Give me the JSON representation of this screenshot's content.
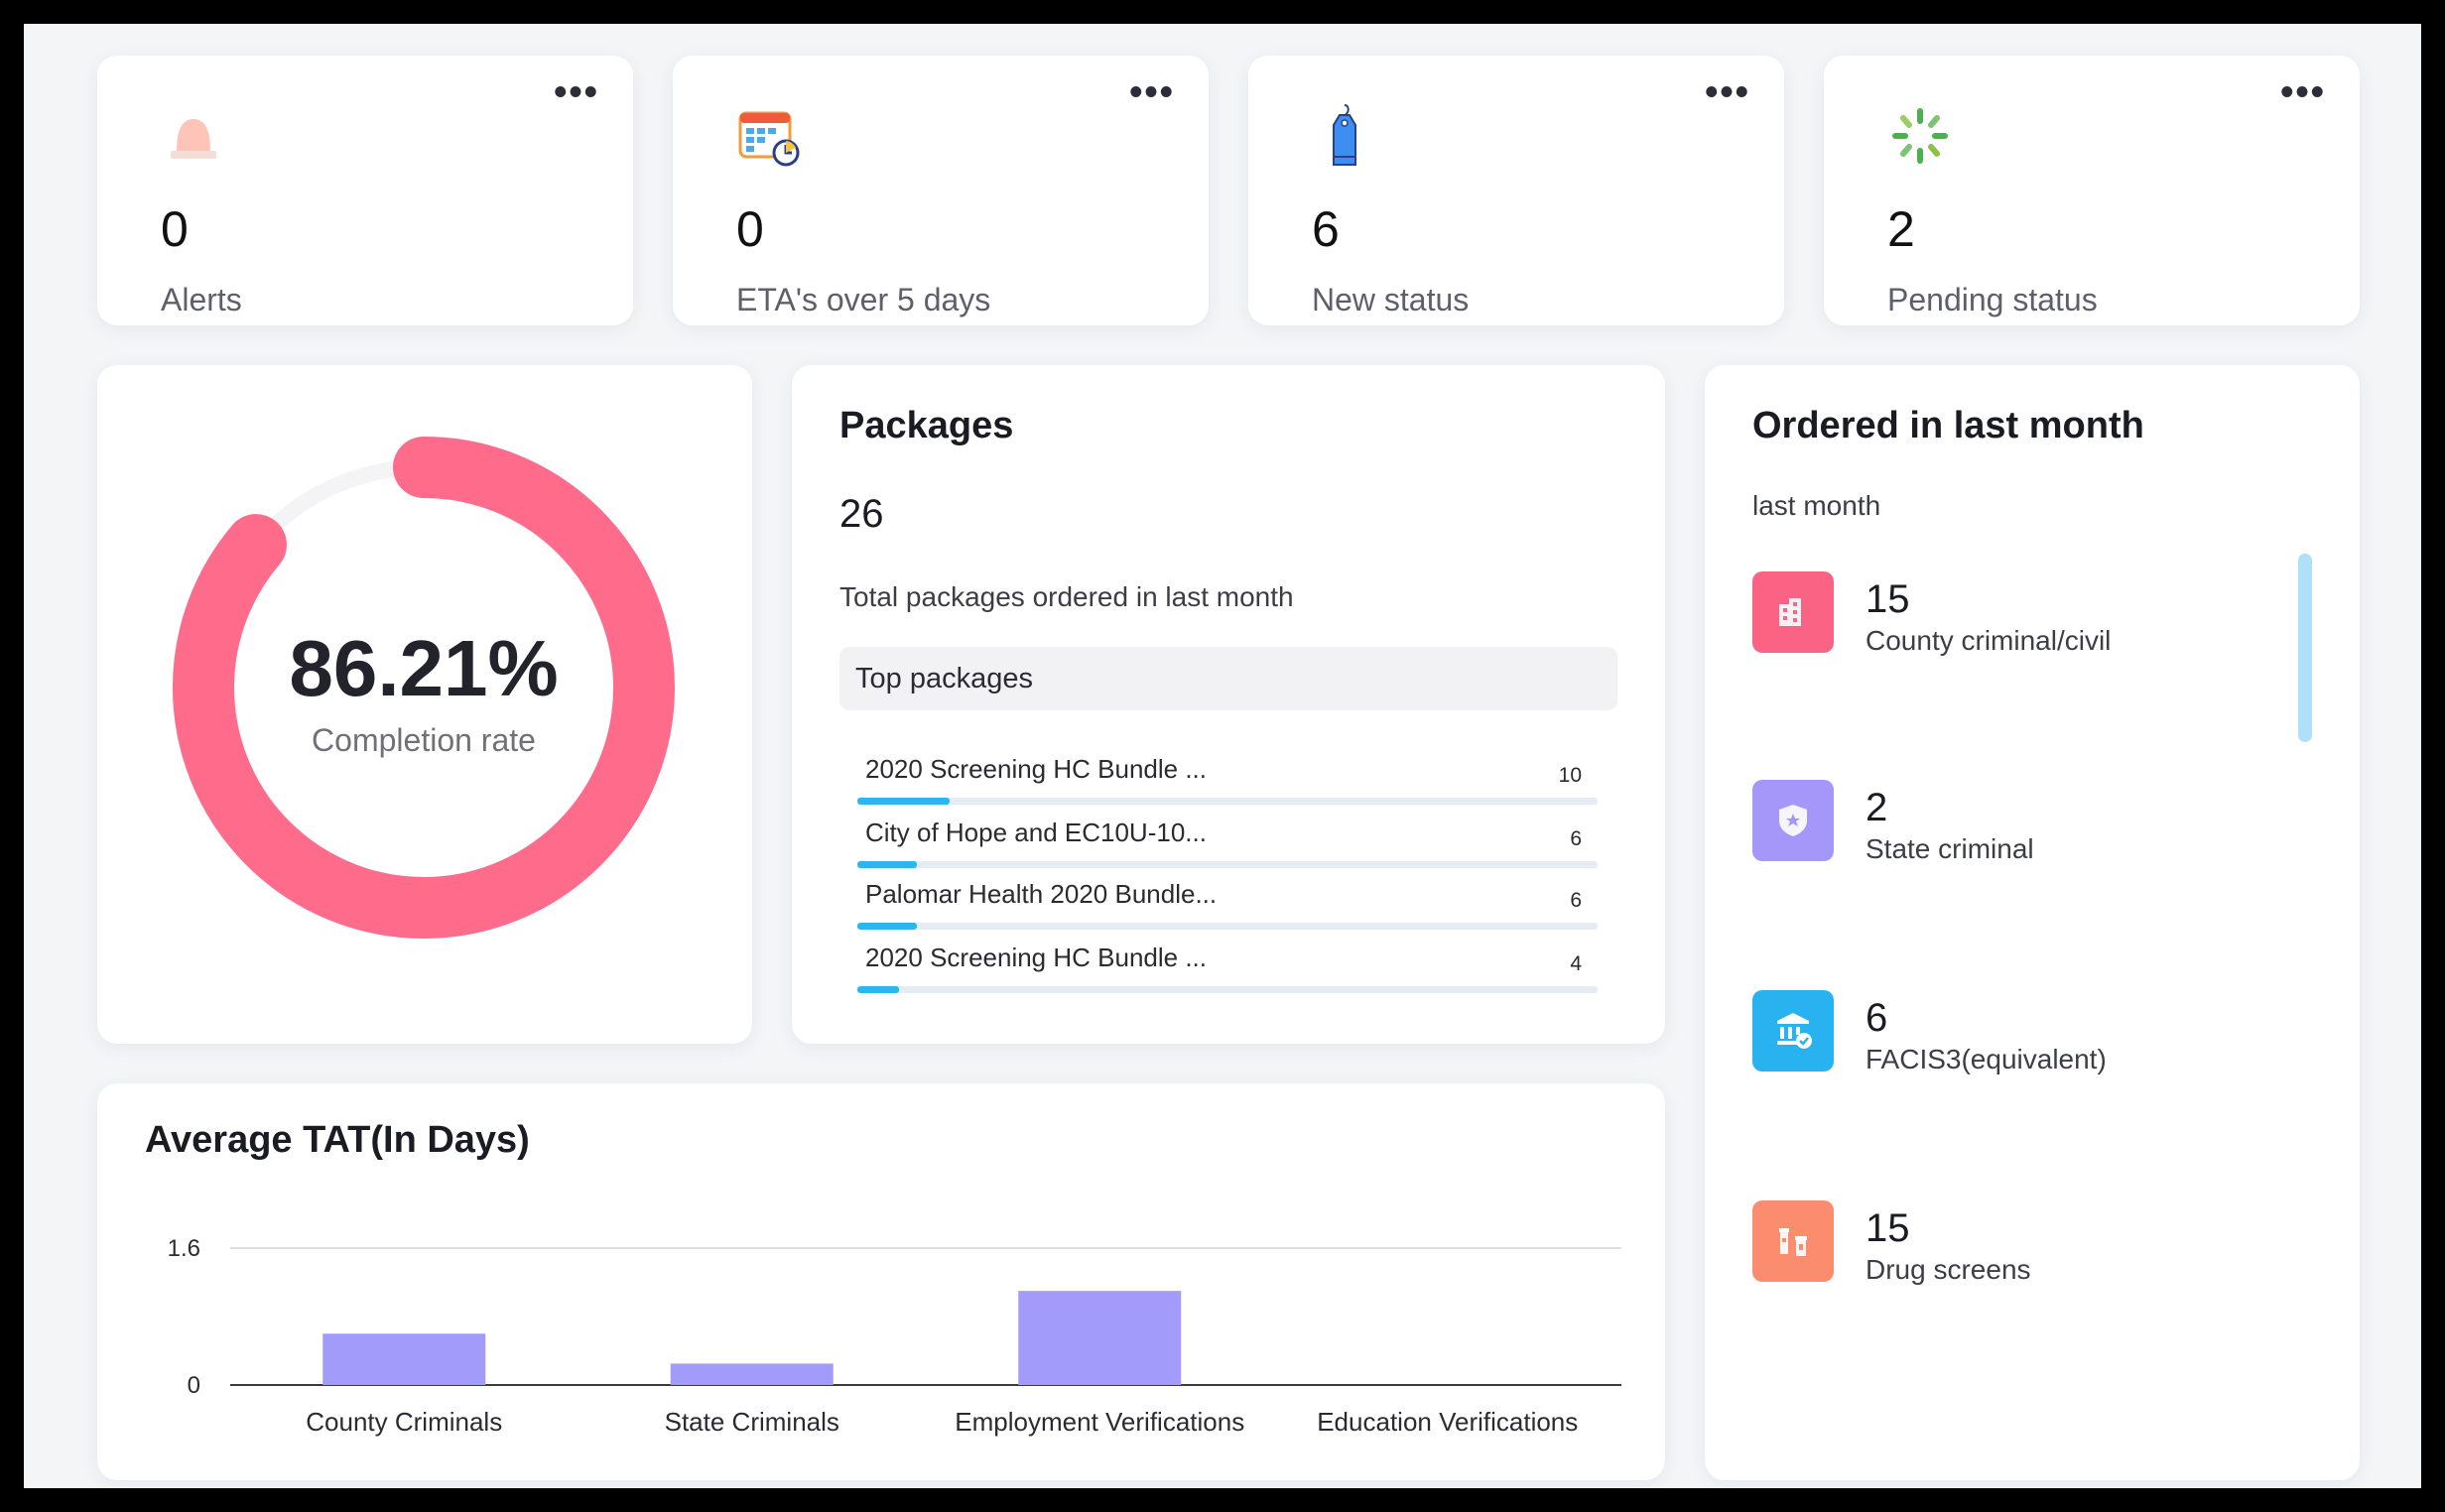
{
  "stats": [
    {
      "value": "0",
      "label": "Alerts",
      "icon": "alarm-siren-icon"
    },
    {
      "value": "0",
      "label": "ETA's over 5 days",
      "icon": "calendar-clock-icon"
    },
    {
      "value": "6",
      "label": "New status",
      "icon": "tag-icon"
    },
    {
      "value": "2",
      "label": "Pending status",
      "icon": "loading-spinner-icon"
    }
  ],
  "menu_glyph": "•••",
  "completion": {
    "percent_text": "86.21%",
    "label": "Completion rate",
    "value": 0.8621,
    "color": "#ff6b8a"
  },
  "packages": {
    "title": "Packages",
    "total": "26",
    "subtitle": "Total packages ordered in last month",
    "top_header": "Top packages",
    "items": [
      {
        "name": "2020 Screening HC Bundle ...",
        "count": "10",
        "fraction": 0.125
      },
      {
        "name": "City of Hope and EC10U-10...",
        "count": "6",
        "fraction": 0.08
      },
      {
        "name": "Palomar Health 2020 Bundle...",
        "count": "6",
        "fraction": 0.08
      },
      {
        "name": "2020 Screening HC Bundle ...",
        "count": "4",
        "fraction": 0.056
      }
    ]
  },
  "ordered": {
    "title": "Ordered in last month",
    "subtitle": "last month",
    "items": [
      {
        "value": "15",
        "label": "County criminal/civil",
        "icon": "building-icon",
        "color": "#fb6384"
      },
      {
        "value": "2",
        "label": "State criminal",
        "icon": "shield-star-icon",
        "color": "#a597fa"
      },
      {
        "value": "6",
        "label": "FACIS3(equivalent)",
        "icon": "bank-check-icon",
        "color": "#28b3f0"
      },
      {
        "value": "15",
        "label": "Drug screens",
        "icon": "vials-icon",
        "color": "#fb8c6e"
      }
    ]
  },
  "tat": {
    "title": "Average TAT(In Days)"
  },
  "chart_data": {
    "type": "bar",
    "title": "Average TAT(In Days)",
    "categories": [
      "County Criminals",
      "State Criminals",
      "Employment Verifications",
      "Education Verifications"
    ],
    "values": [
      0.6,
      0.25,
      1.1,
      0
    ],
    "ylim": [
      0,
      1.6
    ],
    "yticks": [
      "0",
      "1.6"
    ],
    "color": "#a29bfa",
    "grid": true
  }
}
